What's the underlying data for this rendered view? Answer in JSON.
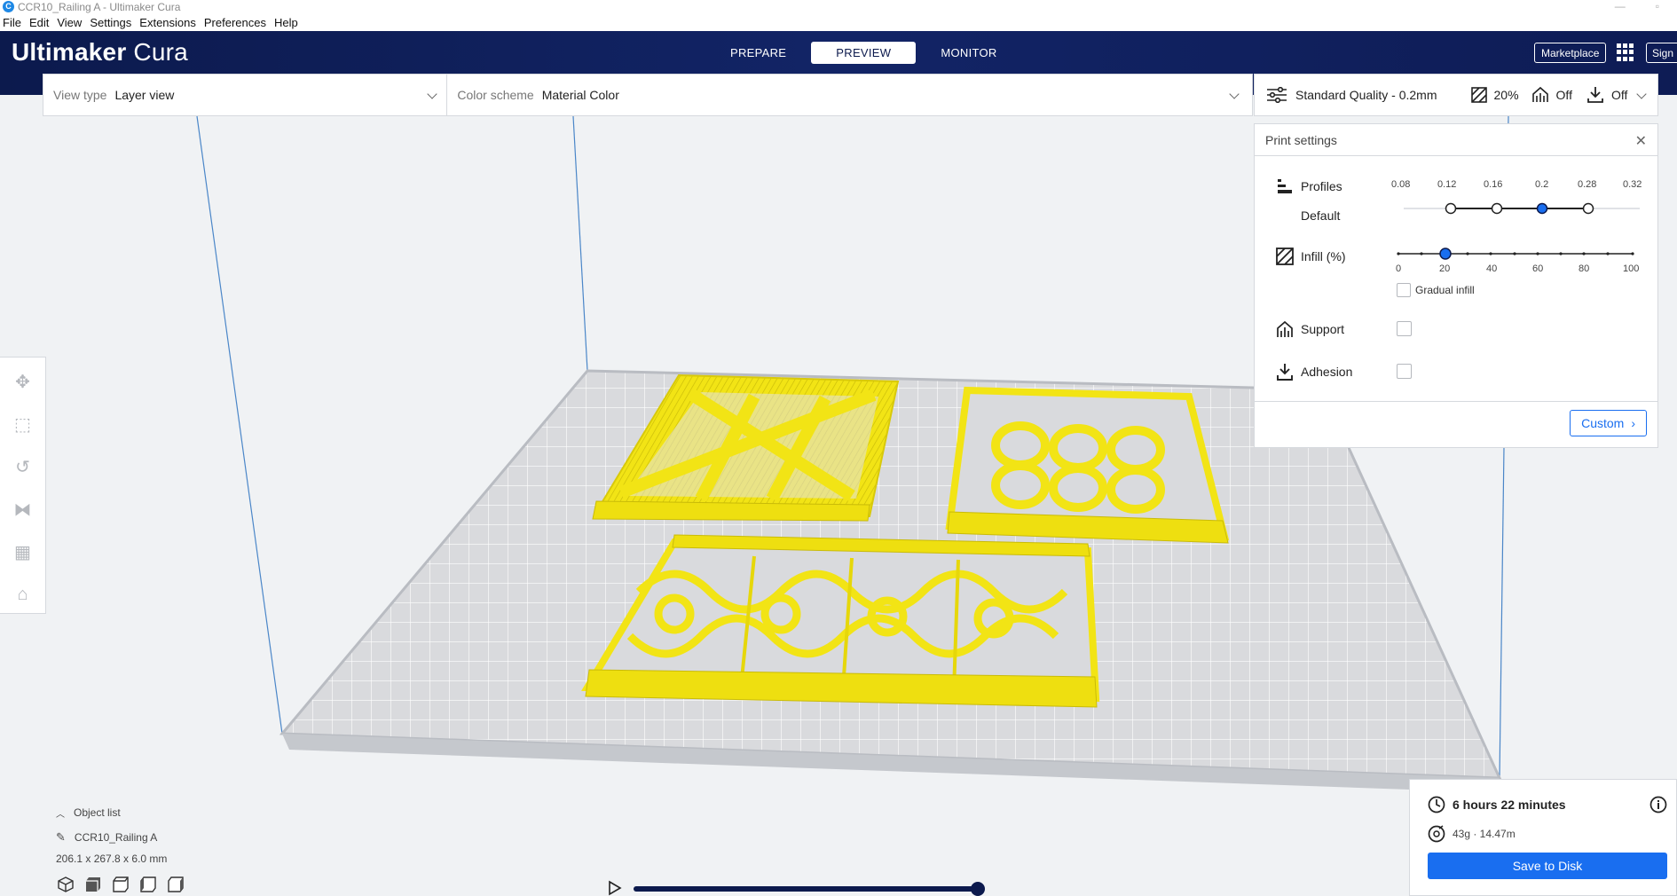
{
  "window": {
    "title": "CCR10_Railing A - Ultimaker Cura"
  },
  "menu": [
    "File",
    "Edit",
    "View",
    "Settings",
    "Extensions",
    "Preferences",
    "Help"
  ],
  "header": {
    "logo_bold": "Ultimaker",
    "logo_light": "Cura",
    "tabs": [
      {
        "label": "PREPARE",
        "active": false
      },
      {
        "label": "PREVIEW",
        "active": true
      },
      {
        "label": "MONITOR",
        "active": false
      }
    ],
    "marketplace": "Marketplace",
    "signin": "Sign"
  },
  "viewbar": {
    "view_type_label": "View type",
    "view_type_value": "Layer view",
    "color_scheme_label": "Color scheme",
    "color_scheme_value": "Material Color"
  },
  "quality": {
    "profile": "Standard Quality - 0.2mm",
    "infill": "20%",
    "support": "Off",
    "adhesion": "Off"
  },
  "print_settings": {
    "title": "Print settings",
    "profiles_label": "Profiles",
    "profile_default": "Default",
    "layer_heights": [
      "0.08",
      "0.12",
      "0.16",
      "0.2",
      "0.28",
      "0.32"
    ],
    "selected_layer_height": "0.2",
    "infill_label": "Infill (%)",
    "infill_ticks": [
      "0",
      "20",
      "40",
      "60",
      "80",
      "100"
    ],
    "infill_value": 20,
    "gradual_infill": "Gradual infill",
    "support_label": "Support",
    "adhesion_label": "Adhesion",
    "custom_button": "Custom"
  },
  "object_list": {
    "label": "Object list",
    "object_name": "CCR10_Railing A",
    "dimensions": "206.1 x 267.8 x 6.0 mm"
  },
  "action": {
    "print_time": "6 hours 22 minutes",
    "material": "43g · 14.47m",
    "save": "Save to Disk"
  },
  "colors": {
    "header_bg": "#0c1a4d",
    "accent": "#196ef0",
    "model": "#f2e415",
    "build_plate": "#d9dadd"
  },
  "layer_slider_value": 1.0
}
